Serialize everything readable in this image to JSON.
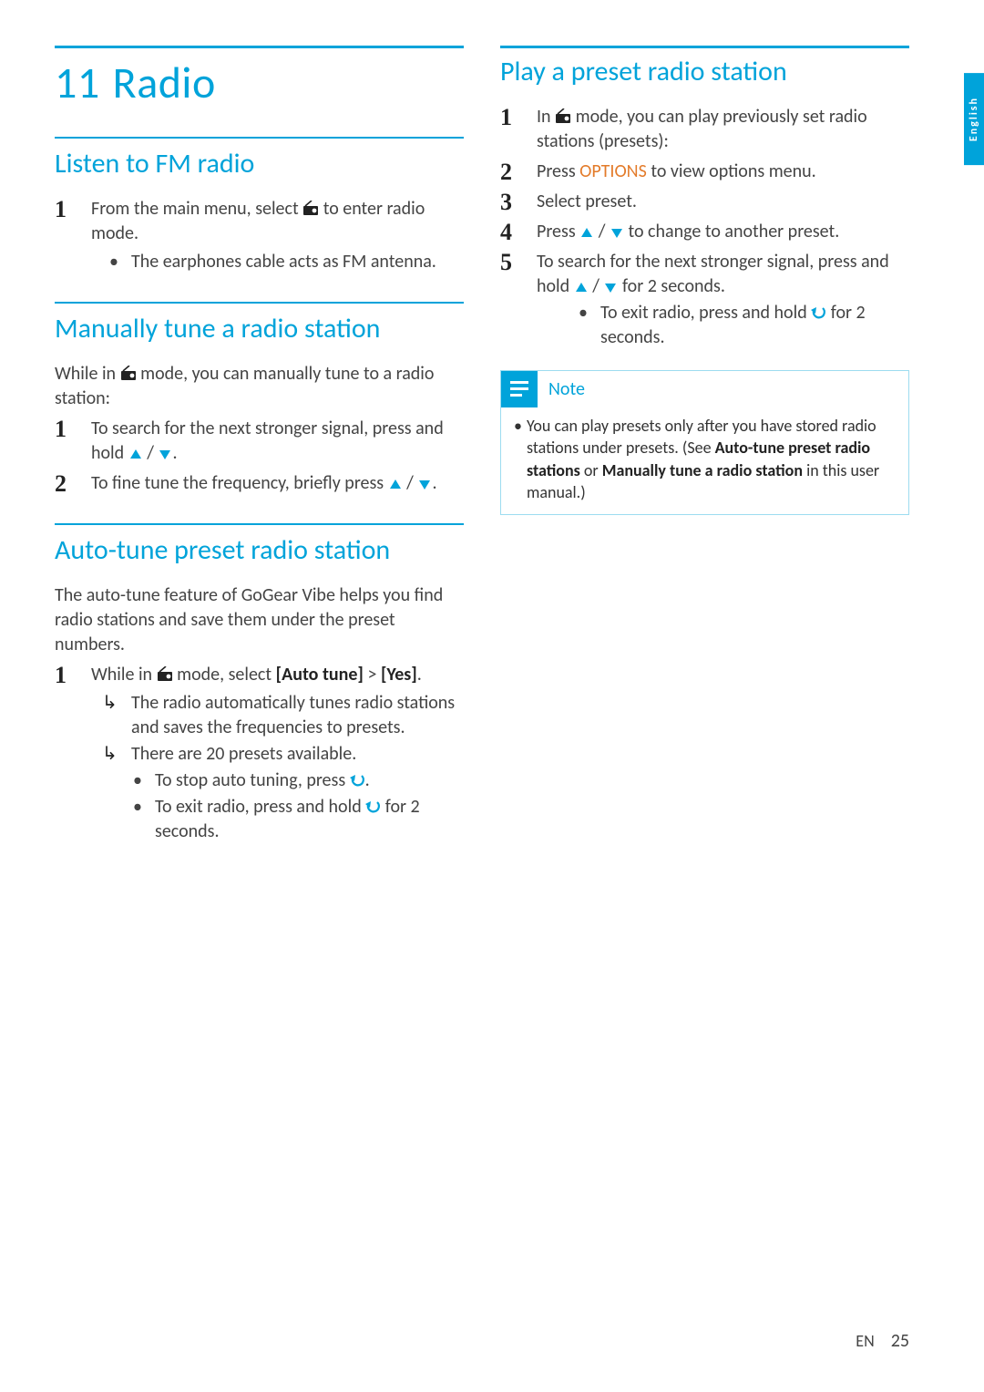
{
  "chapter": {
    "number": "11",
    "title": "Radio"
  },
  "lang_tab": "English",
  "footer": {
    "lang": "EN",
    "page": "25"
  },
  "icons": {
    "radio": "radio-icon",
    "up": "▲",
    "down": "▼",
    "back": "back-icon"
  },
  "left": {
    "s1": {
      "heading": "Listen to FM radio",
      "step1_a": "From the main menu, select ",
      "step1_b": " to enter radio mode.",
      "sub1": "The earphones cable acts as FM antenna."
    },
    "s2": {
      "heading": "Manually tune a radio station",
      "intro_a": "While in ",
      "intro_b": " mode, you can manually tune to a radio station:",
      "step1_a": "To search for the next stronger signal, press and hold ",
      "step1_b": " / ",
      "step1_c": ".",
      "step2_a": "To fine tune the frequency, briefly press ",
      "step2_b": " / ",
      "step2_c": "."
    },
    "s3": {
      "heading": "Auto-tune preset radio station",
      "intro": "The auto-tune feature of GoGear Vibe helps you find radio stations and save them under the preset numbers.",
      "step1_a": "While in ",
      "step1_b": " mode, select ",
      "step1_bold": "[Auto tune]",
      "step1_c": " > ",
      "step1_bold2": "[Yes]",
      "step1_d": ".",
      "arrow1": "The radio automatically tunes radio stations and saves the frequencies to presets.",
      "arrow2": "There are 20 presets available.",
      "bullet1_a": "To stop auto tuning, press ",
      "bullet1_b": ".",
      "bullet2_a": "To exit radio, press and hold ",
      "bullet2_b": " for 2 seconds."
    }
  },
  "right": {
    "s1": {
      "heading": "Play a preset radio station",
      "step1_a": "In ",
      "step1_b": " mode, you can play previously set radio stations (presets):",
      "step2_a": "Press ",
      "step2_kw": "OPTIONS",
      "step2_b": " to view options menu.",
      "step3": "Select preset.",
      "step4_a": "Press ",
      "step4_b": " / ",
      "step4_c": " to change to another preset.",
      "step5_a": "To search for the next stronger signal, press and hold ",
      "step5_b": " / ",
      "step5_c": " for 2 seconds.",
      "sub_a": "To exit radio, press and hold ",
      "sub_b": " for 2 seconds."
    },
    "note": {
      "title": "Note",
      "body_a": "You can play presets only after you have stored radio stations under presets. (See ",
      "body_bold1": "Auto-tune preset radio stations",
      "body_b": " or ",
      "body_bold2": "Manually tune a radio station",
      "body_c": " in this user manual.)"
    }
  }
}
